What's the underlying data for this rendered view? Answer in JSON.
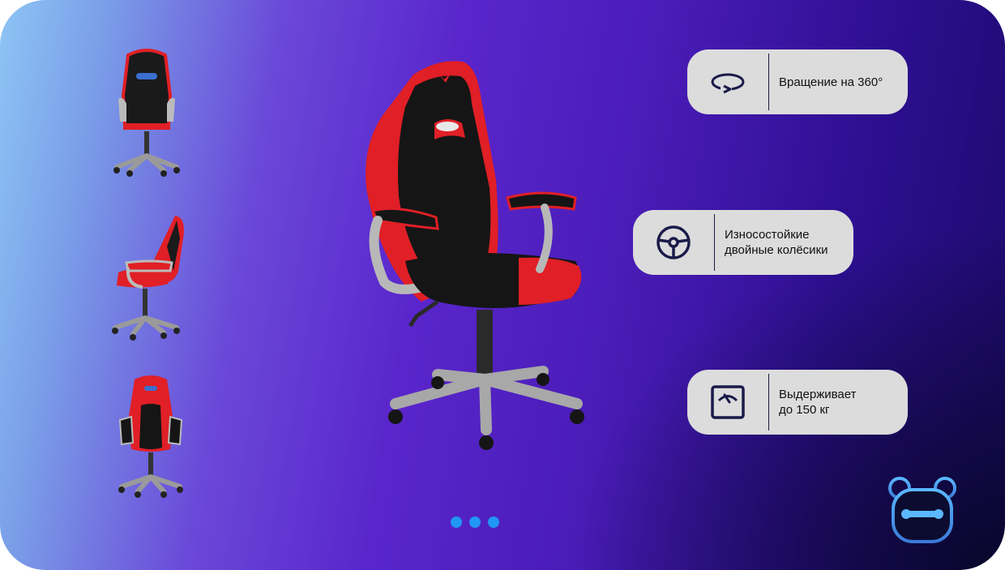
{
  "features": [
    {
      "icon": "rotate-360-icon",
      "lines": [
        "Вращение на 360°"
      ]
    },
    {
      "icon": "wheel-icon",
      "lines": [
        "Износостойкие",
        "двойные колёсики"
      ]
    },
    {
      "icon": "scale-icon",
      "lines": [
        "Выдерживает",
        "до 150 кг"
      ]
    }
  ],
  "thumbnails": [
    "back-view",
    "side-view",
    "front-view"
  ],
  "carousel": {
    "dots": 3,
    "active": 0
  },
  "colors": {
    "accent": "#2196f3",
    "chair_red": "#e01f26",
    "chair_black": "#151515",
    "panel": "#dcdcdc",
    "icon": "#1a1a4a"
  }
}
